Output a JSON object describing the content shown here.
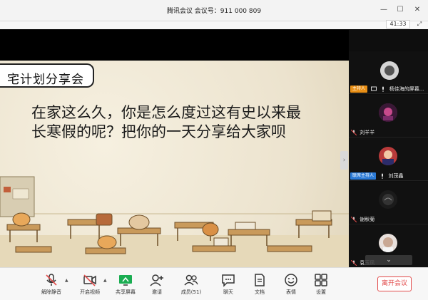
{
  "titlebar": {
    "title": "腾讯会议 会议号：911 000 809"
  },
  "meeting": {
    "timer": "41:33"
  },
  "slide": {
    "badge": "宅计划分享会",
    "body": "在家这么久，你是怎么度过这有史以来最长寒假的呢？把你的一天分享给大家呗"
  },
  "participants": [
    {
      "name": "杨佳海的屏幕...",
      "role": "主持人",
      "role_color": "#e88f16"
    },
    {
      "name": "刘羊羊",
      "role": ""
    },
    {
      "name": "刘茂鑫",
      "role": "联席主持人",
      "role_color": "#2b7ad6"
    },
    {
      "name": "谢秋菊",
      "role": ""
    },
    {
      "name": "袁玉凤",
      "role": ""
    }
  ],
  "toolbar": {
    "mute_label": "解除静音",
    "video_label": "开启视频",
    "share_label": "共享屏幕",
    "invite_label": "邀请",
    "members_label": "成员(51)",
    "chat_label": "聊天",
    "docs_label": "文档",
    "emoji_label": "表情",
    "settings_label": "设置",
    "leave_label": "离开会议"
  },
  "colors": {
    "accent_green": "#1aad52",
    "leave_red": "#e24b4b",
    "host_orange": "#e88f16",
    "cohost_blue": "#2b7ad6"
  }
}
